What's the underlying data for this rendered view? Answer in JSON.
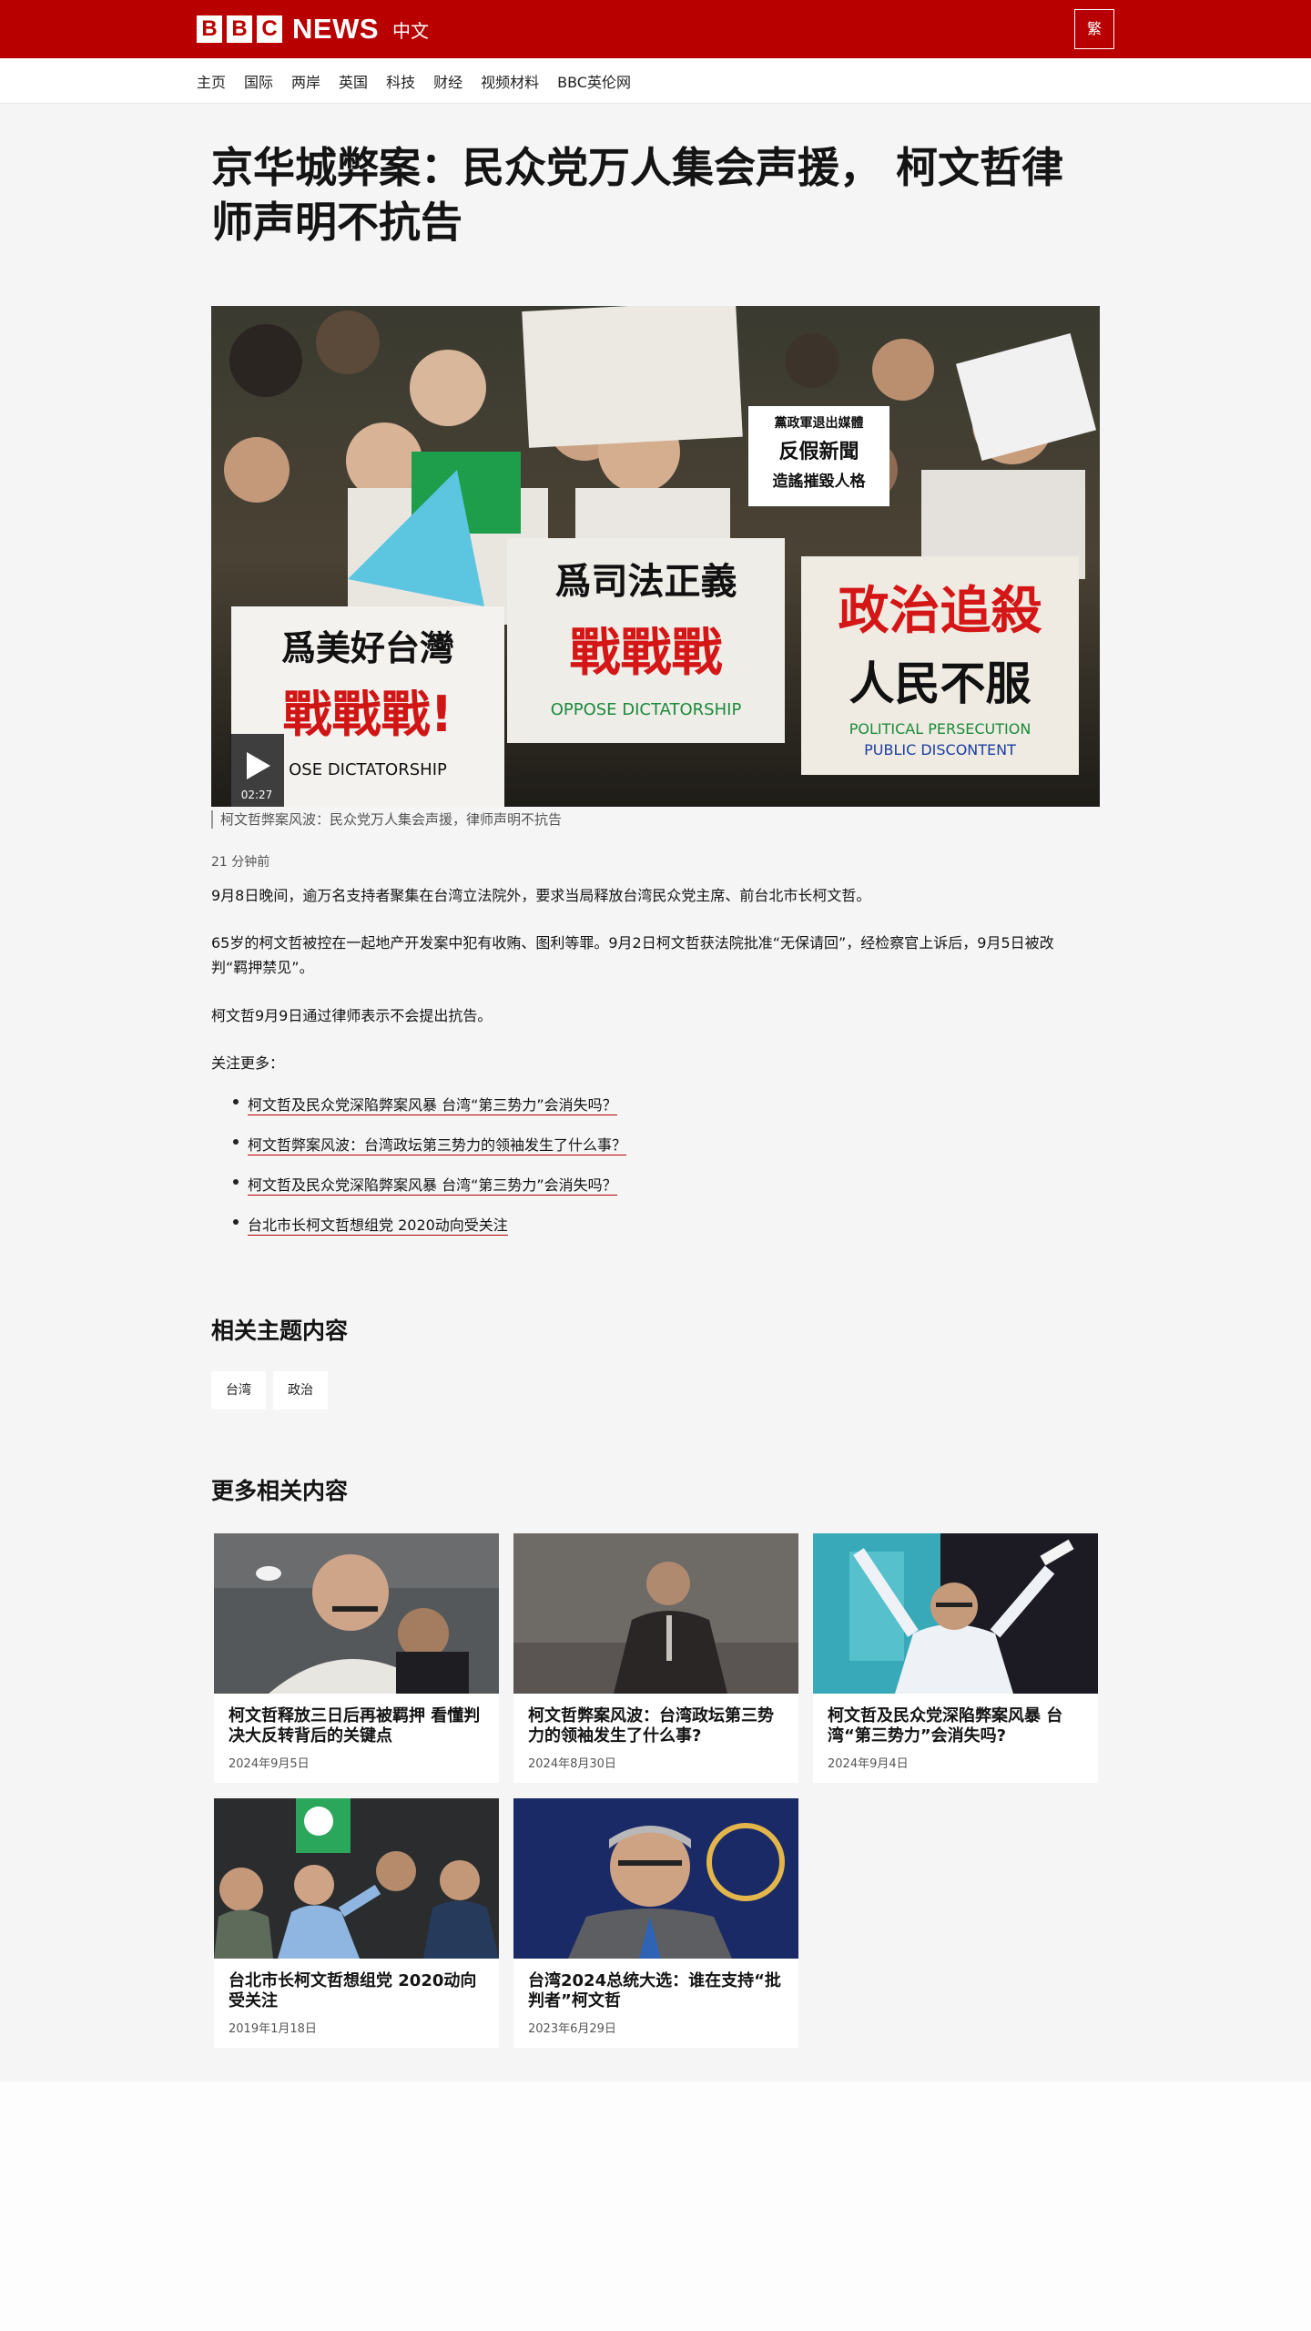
{
  "header": {
    "logo_b1": "B",
    "logo_b2": "B",
    "logo_c": "C",
    "logo_news": "NEWS",
    "logo_lang": "中文",
    "lang_toggle": "繁"
  },
  "nav": {
    "items": [
      "主页",
      "国际",
      "两岸",
      "英国",
      "科技",
      "财经",
      "视频材料",
      "BBC英伦网"
    ]
  },
  "article": {
    "headline": "京华城弊案：民众党万人集会声援， 柯文哲律师声明不抗告",
    "video": {
      "duration": "02:27",
      "caption": "柯文哲弊案风波：民众党万人集会声援，律师声明不抗告",
      "signs": {
        "sign1_line1": "爲美好台灣",
        "sign1_line2": "戰戰戰!",
        "sign2_line1": "爲司法正義",
        "sign2_line2": "戰戰戰",
        "sign2_line3": "OPPOSE DICTATORSHIP",
        "sign3_line1": "政治追殺",
        "sign3_line2": "人民不服",
        "sign3_line3": "POLITICAL PERSECUTION",
        "sign3_line4": "PUBLIC DISCONTENT",
        "sign4_line1": "黨政軍退出媒體",
        "sign4_line2": "反假新聞",
        "sign4_line3": "造謠摧毀人格",
        "bottom_text": "OSE DICTATORSHIP"
      }
    },
    "timestamp": "21 分钟前",
    "paragraphs": [
      "9月8日晚间，逾万名支持者聚集在台湾立法院外，要求当局释放台湾民众党主席、前台北市长柯文哲。",
      "65岁的柯文哲被控在一起地产开发案中犯有收贿、图利等罪。9月2日柯文哲获法院批准“无保请回”，经检察官上诉后，9月5日被改判“羁押禁见”。",
      "柯文哲9月9日通过律师表示不会提出抗告。",
      "关注更多："
    ],
    "related_links": [
      "柯文哲及民众党深陷弊案风暴 台湾“第三势力”会消失吗？",
      "柯文哲弊案风波：台湾政坛第三势力的领袖发生了什么事？",
      "柯文哲及民众党深陷弊案风暴 台湾“第三势力”会消失吗？",
      "台北市长柯文哲想组党 2020动向受关注"
    ]
  },
  "topics": {
    "title": "相关主题内容",
    "tags": [
      "台湾",
      "政治"
    ]
  },
  "more": {
    "title": "更多相关内容",
    "cards": [
      {
        "title": "柯文哲释放三日后再被羁押 看懂判决大反转背后的关键点",
        "date": "2024年9月5日"
      },
      {
        "title": "柯文哲弊案风波：台湾政坛第三势力的领袖发生了什么事?",
        "date": "2024年8月30日"
      },
      {
        "title": "柯文哲及民众党深陷弊案风暴 台湾“第三势力”会消失吗?",
        "date": "2024年9月4日"
      },
      {
        "title": "台北市长柯文哲想组党 2020动向受关注",
        "date": "2019年1月18日"
      },
      {
        "title": "台湾2024总统大选：谁在支持“批判者”柯文哲",
        "date": "2023年6月29日"
      }
    ]
  },
  "colors": {
    "brand_red": "#b80000",
    "page_bg": "#f5f5f5"
  }
}
